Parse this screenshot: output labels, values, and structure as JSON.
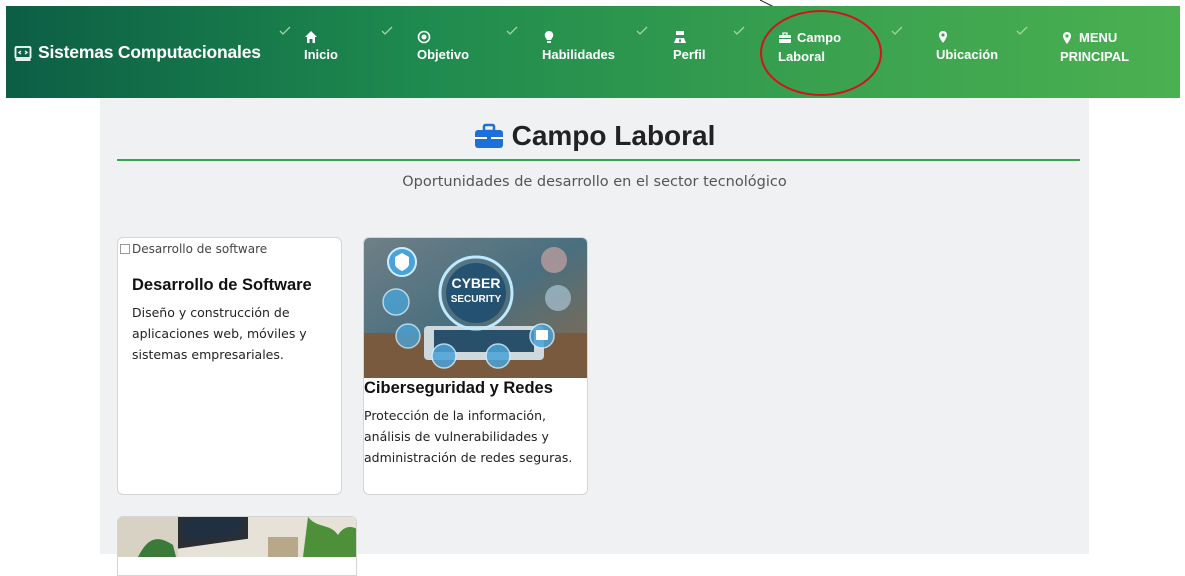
{
  "brand": {
    "title": "Sistemas Computacionales",
    "icon": "code-window-icon"
  },
  "nav": {
    "items": [
      {
        "label": "Inicio",
        "icon": "home-icon"
      },
      {
        "label": "Objetivo",
        "icon": "target-icon"
      },
      {
        "label": "Habilidades",
        "icon": "lightbulb-icon"
      },
      {
        "label": "Perfil",
        "icon": "user-tie-icon"
      },
      {
        "label_line1": "Campo",
        "label_line2": "Laboral",
        "icon": "briefcase-icon",
        "active": true
      },
      {
        "label": "Ubicación",
        "icon": "map-pin-icon"
      },
      {
        "label_line1": "MENU",
        "label_line2": "PRINCIPAL",
        "icon": "map-pin-icon"
      }
    ]
  },
  "section": {
    "title": "Campo Laboral",
    "subtitle": "Oportunidades de desarrollo en el sector tecnológico"
  },
  "cards": [
    {
      "image_alt": "Desarrollo de software",
      "title": "Desarrollo de Software",
      "description": "Diseño y construcción de aplicaciones web, móviles y sistemas empresariales."
    },
    {
      "image_text_line1": "CYBER",
      "image_text_line2": "SECURITY",
      "title": "Ciberseguridad y Redes",
      "description": "Protección de la información, análisis de vulnerabilidades y administración de redes seguras."
    }
  ],
  "colors": {
    "nav_start": "#0c5e45",
    "nav_end": "#4bb051",
    "accent": "#3aa14f",
    "annotation": "#d1141a",
    "icon_blue": "#1e6fd9"
  }
}
